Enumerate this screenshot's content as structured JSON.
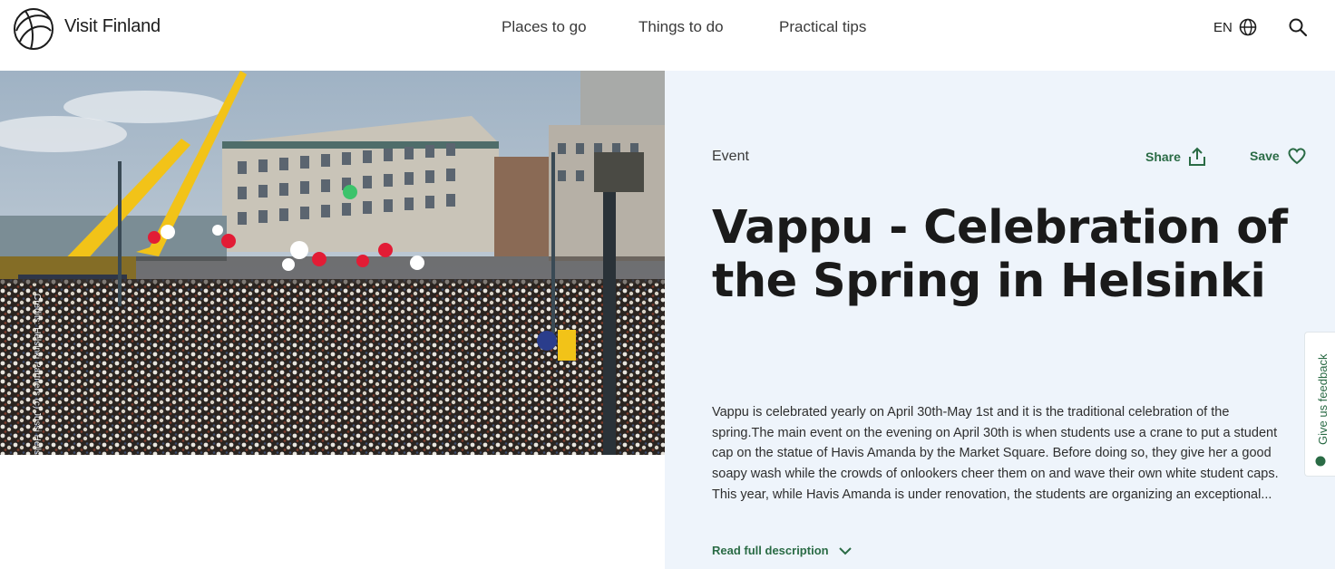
{
  "header": {
    "brand": "Visit Finland",
    "nav": [
      {
        "label": "Places to go"
      },
      {
        "label": "Things to do"
      },
      {
        "label": "Practical tips"
      }
    ],
    "language": "EN"
  },
  "hero": {
    "credit": "Credits: Helsinki Partners (c) Jussi Hellsten"
  },
  "event": {
    "category": "Event",
    "share_label": "Share",
    "save_label": "Save",
    "title": "Vappu - Celebration of the Spring in Helsinki",
    "description_lines": [
      "Vappu is celebrated yearly on April 30th-May 1st and it is the traditional celebration of the",
      "spring.The main event on the evening on April 30th is when students use a crane to put a student",
      "cap on the statue of Havis Amanda by the Market Square. Before doing so, they give her a good",
      "soapy wash while the crowds of onlookers cheer them on and wave their own white student caps.",
      "This year, while Havis Amanda is under renovation, the students are organizing an exceptional..."
    ],
    "read_more": "Read full description"
  },
  "feedback": {
    "label": "Give us feedback"
  },
  "colors": {
    "accent": "#2a6b45",
    "panel_bg": "#eef4fb"
  }
}
